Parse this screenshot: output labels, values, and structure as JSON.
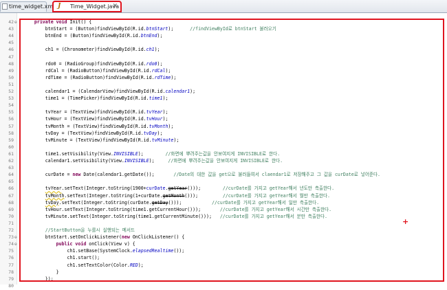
{
  "tabs": [
    {
      "label": "time_widget.xml"
    },
    {
      "label": "Time_Widget.java"
    }
  ],
  "code_lines": [
    {
      "n": "42",
      "fold": "⊖",
      "segs": [
        [
          "",
          "    "
        ],
        [
          "kw",
          "private void"
        ],
        [
          "",
          " Init() {"
        ]
      ]
    },
    {
      "n": "43",
      "segs": [
        [
          "",
          "        btnStart = (Button)findViewById(R.id."
        ],
        [
          "fldi",
          "btnStart"
        ],
        [
          "",
          "); "
        ],
        [
          "cm",
          "     //findViewById로 btnStart 불러오기"
        ]
      ]
    },
    {
      "n": "44",
      "segs": [
        [
          "",
          "        btnEnd = (Button)findViewById(R.id."
        ],
        [
          "fldi",
          "btnEnd"
        ],
        [
          "",
          "); "
        ]
      ]
    },
    {
      "n": "45",
      "segs": [
        [
          "",
          ""
        ]
      ]
    },
    {
      "n": "46",
      "segs": [
        [
          "",
          "        ch1 = (Chronometer)findViewById(R.id."
        ],
        [
          "fldi",
          "ch1"
        ],
        [
          "",
          "); "
        ]
      ]
    },
    {
      "n": "47",
      "segs": [
        [
          "",
          ""
        ]
      ]
    },
    {
      "n": "48",
      "segs": [
        [
          "",
          "        rdo0 = (RadioGroup)findViewById(R.id."
        ],
        [
          "fldi",
          "rdo0"
        ],
        [
          "",
          "); "
        ]
      ]
    },
    {
      "n": "49",
      "segs": [
        [
          "",
          "        rdCal = (RadioButton)findViewById(R.id."
        ],
        [
          "fldi",
          "rdCal"
        ],
        [
          "",
          "); "
        ]
      ]
    },
    {
      "n": "50",
      "segs": [
        [
          "",
          "        rdTime = (RadioButton)findViewById(R.id."
        ],
        [
          "fldi",
          "rdTime"
        ],
        [
          "",
          "); "
        ]
      ]
    },
    {
      "n": "51",
      "segs": [
        [
          "",
          ""
        ]
      ]
    },
    {
      "n": "52",
      "segs": [
        [
          "",
          "        calendar1 = (CalendarView)findViewById(R.id."
        ],
        [
          "fldi",
          "calendar1"
        ],
        [
          "",
          "); "
        ]
      ]
    },
    {
      "n": "53",
      "segs": [
        [
          "",
          "        time1 = (TimePicker)findViewById(R.id."
        ],
        [
          "fldi",
          "time1"
        ],
        [
          "",
          "); "
        ]
      ]
    },
    {
      "n": "54",
      "segs": [
        [
          "",
          ""
        ]
      ]
    },
    {
      "n": "55",
      "segs": [
        [
          "",
          "        tvYear = (TextView)findViewById(R.id."
        ],
        [
          "fldi",
          "tvYear"
        ],
        [
          "",
          "); "
        ]
      ]
    },
    {
      "n": "56",
      "segs": [
        [
          "",
          "        tvHour = (TextView)findViewById(R.id."
        ],
        [
          "fldi",
          "tvHour"
        ],
        [
          "",
          "); "
        ]
      ]
    },
    {
      "n": "57",
      "segs": [
        [
          "",
          "        tvMonth = (TextView)findViewById(R.id."
        ],
        [
          "fldi",
          "tvMonth"
        ],
        [
          "",
          "); "
        ]
      ]
    },
    {
      "n": "58",
      "segs": [
        [
          "",
          "        tvDay = (TextView)findViewById(R.id."
        ],
        [
          "fldi",
          "tvDay"
        ],
        [
          "",
          "); "
        ]
      ]
    },
    {
      "n": "59",
      "segs": [
        [
          "",
          "        tvMinute = (TextView)findViewById(R.id."
        ],
        [
          "fldi",
          "tvMinute"
        ],
        [
          "",
          "); "
        ]
      ]
    },
    {
      "n": "60",
      "segs": [
        [
          "",
          ""
        ]
      ]
    },
    {
      "n": "61",
      "segs": [
        [
          "",
          "        time1.setVisibility(View."
        ],
        [
          "fldi",
          "INVISIBLE"
        ],
        [
          "",
          "); "
        ],
        [
          "cm",
          "       //화면에 뿌려주는값을 안보여지게 INVISIBLE로 한다."
        ]
      ]
    },
    {
      "n": "62",
      "segs": [
        [
          "",
          "        calendar1.setVisibility(View."
        ],
        [
          "fldi",
          "INVISIBLE"
        ],
        [
          "",
          "); "
        ],
        [
          "cm",
          "    //화면에 뿌려주는값을 안보여지게 INVISIBLE로 한다."
        ]
      ]
    },
    {
      "n": "63",
      "segs": [
        [
          "",
          ""
        ]
      ]
    },
    {
      "n": "64",
      "segs": [
        [
          "",
          "        curDate = "
        ],
        [
          "kw",
          "new"
        ],
        [
          "",
          " Date(calendar1.getDate()); "
        ],
        [
          "cm",
          "      //Date의 대한 값을 get으로 불러들여서 claendar1로 저장해주고 그 값을 curDate로 넣어준다."
        ]
      ]
    },
    {
      "n": "65",
      "segs": [
        [
          "",
          ""
        ]
      ]
    },
    {
      "n": "66",
      "segs": [
        [
          "",
          "        "
        ],
        [
          "warn",
          "tvYear"
        ],
        [
          "",
          ".setText(Integer.toString(1900+"
        ],
        [
          "fld",
          "curDate"
        ],
        [
          "",
          "."
        ],
        [
          "str",
          "getYear"
        ],
        [
          "",
          "())); "
        ],
        [
          "cm",
          "       //curDate를 가지고 getYear해서 년도만 측출한다."
        ]
      ]
    },
    {
      "n": "67",
      "segs": [
        [
          "",
          "        "
        ],
        [
          "warn",
          "tvMonth"
        ],
        [
          "",
          ".setText(Integer.toString(1+curDate."
        ],
        [
          "str",
          "getMonth"
        ],
        [
          "",
          "())); "
        ],
        [
          "cm",
          "        //curDate를 가지고 getYear해서 월만 측출한다."
        ]
      ]
    },
    {
      "n": "68",
      "segs": [
        [
          "",
          "        "
        ],
        [
          "warn",
          "tvDay"
        ],
        [
          "",
          ".setText(Integer.toString(curDate."
        ],
        [
          "str",
          "getDay"
        ],
        [
          "",
          "())); "
        ],
        [
          "cm",
          "          //curDate를 가지고 getYear해서 일만 측출한다."
        ]
      ]
    },
    {
      "n": "69",
      "segs": [
        [
          "",
          "        tvHour.setText(Integer.toString(time1.getCurrentHour())); "
        ],
        [
          "cm",
          "      //curDate를 가지고 getYear해서 시간만 측출한다."
        ]
      ]
    },
    {
      "n": "70",
      "segs": [
        [
          "",
          "        tvMinute.setText(Integer.toString(time1.getCurrentMinute())); "
        ],
        [
          "cm",
          "  //curDate를 가지고 getYear해서 분만 측출한다."
        ]
      ]
    },
    {
      "n": "71",
      "segs": [
        [
          "",
          ""
        ]
      ]
    },
    {
      "n": "72",
      "segs": [
        [
          "cm",
          "        //StartButton을 누를시 실행되는 메서드"
        ]
      ]
    },
    {
      "n": "73",
      "fold": "⊖",
      "segs": [
        [
          "",
          "        btnStart.setOnClickListener("
        ],
        [
          "kw",
          "new"
        ],
        [
          "",
          " OnClickListener() {"
        ]
      ]
    },
    {
      "n": "74",
      "fold": "⊖",
      "segs": [
        [
          "",
          "            "
        ],
        [
          "kw",
          "public void"
        ],
        [
          "",
          " onClick(View v) {"
        ]
      ]
    },
    {
      "n": "75",
      "segs": [
        [
          "",
          "                ch1.setBase(SystemClock."
        ],
        [
          "fldi",
          "elapsedRealtime"
        ],
        [
          "",
          "()); "
        ]
      ]
    },
    {
      "n": "76",
      "segs": [
        [
          "",
          "                ch1.start(); "
        ]
      ]
    },
    {
      "n": "77",
      "segs": [
        [
          "",
          "                ch1.setTextColor(Color."
        ],
        [
          "fldi",
          "RED"
        ],
        [
          "",
          "); "
        ]
      ]
    },
    {
      "n": "78",
      "segs": [
        [
          "",
          "            }"
        ]
      ]
    },
    {
      "n": "79",
      "segs": [
        [
          "",
          "        }); "
        ]
      ]
    },
    {
      "n": "80",
      "segs": [
        [
          "",
          ""
        ]
      ]
    }
  ],
  "colors": {
    "highlight": "#e0141e",
    "keyword": "#7f0055",
    "comment": "#3f7f5f",
    "field": "#0000c0"
  },
  "icons": {
    "xml_tab": "xml-file-icon",
    "java_tab": "java-file-icon",
    "close": "close-icon",
    "cursor": "crosshair-cursor-icon"
  }
}
